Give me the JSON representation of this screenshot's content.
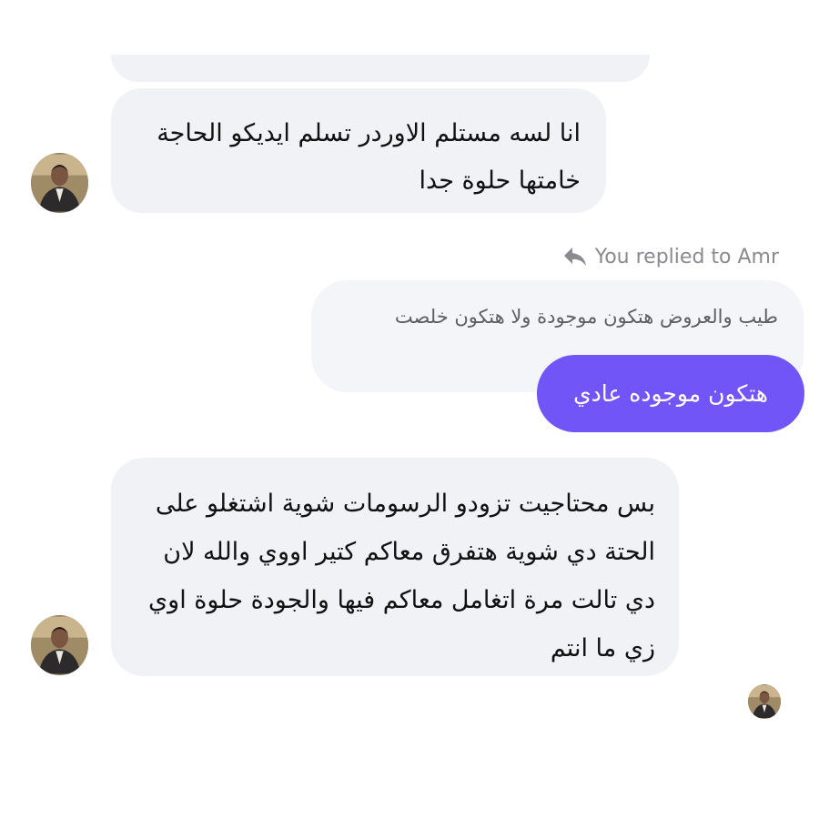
{
  "conversation": {
    "messages": [
      {
        "text": "انا لسه مستلم الاوردر تسلم ايديكو الحاجة خامتها حلوة جدا"
      },
      {
        "reply_indicator": "You replied to Amr",
        "quoted_text": "طيب والعروض هتكون موجودة ولا هتكون خلصت",
        "text": "هتكون موجوده عادي"
      },
      {
        "text": "بس محتاجيت تزودو الرسومات شوية اشتغلو على الحتة دي شوية هتفرق معاكم كتير اووي والله لان دي تالت مرة اتغامل معاكم فيها والجودة حلوة اوي زي ما انتم"
      }
    ]
  },
  "colors": {
    "incoming_bubble": "#f1f2f6",
    "outgoing_bubble": "#7155f6",
    "meta_text": "#8a8a90"
  },
  "icons": {
    "reply": "reply-arrow-icon",
    "avatar": "user-photo"
  }
}
